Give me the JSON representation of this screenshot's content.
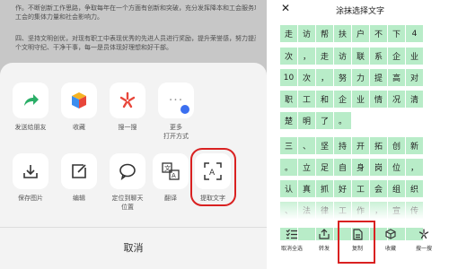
{
  "left": {
    "doc_lines": [
      "作。不断创新工作思路，争取每年在一个方面有创新和突破，充分发挥降本和工会服务功能的作用，扩大",
      "工会的集体力量和社会影响力。",
      "",
      "四、坚持文明创优，对现有职工中表现优秀的先进人员进行奖励，提升荣誉感，努力提高建设要求，每一",
      "个文明守纪、干净干事，每一是员体现好理想和好干部。"
    ],
    "share_items": [
      {
        "label": "发送给朋友",
        "icon": "share-arrow-icon"
      },
      {
        "label": "收藏",
        "icon": "favorite-cube-icon"
      },
      {
        "label": "搜一搜",
        "icon": "search-star-icon"
      },
      {
        "label": "更多\n打开方式",
        "icon": "more-icon"
      }
    ],
    "action_items": [
      {
        "label": "保存图片",
        "icon": "download-icon"
      },
      {
        "label": "编辑",
        "icon": "edit-icon"
      },
      {
        "label": "定位到聊天\n位置",
        "icon": "chat-bubble-icon"
      },
      {
        "label": "翻译",
        "icon": "translate-icon"
      },
      {
        "label": "提取文字",
        "icon": "extract-text-icon"
      }
    ],
    "cancel_label": "取消",
    "colors": {
      "sheet": "#f3f3f3",
      "highlight": "#d92121",
      "share_green": "#2aae67"
    }
  },
  "right": {
    "close_label": "✕",
    "title": "涂抹选择文字",
    "rows": [
      [
        "走",
        "访",
        "帮",
        "扶",
        "户",
        "不",
        "下",
        "4"
      ],
      [
        "次",
        "，",
        "走",
        "访",
        "联",
        "系",
        "企",
        "业"
      ],
      [
        "10",
        "次",
        "，",
        "努",
        "力",
        "提",
        "高",
        "对"
      ],
      [
        "职",
        "工",
        "和",
        "企",
        "业",
        "情",
        "况",
        "清"
      ],
      [
        "楚",
        "明",
        "了",
        "。"
      ],
      [],
      [
        "三",
        "、",
        "坚",
        "持",
        "开",
        "拓",
        "创",
        "新"
      ],
      [
        "。",
        "立",
        "足",
        "自",
        "身",
        "岗",
        "位",
        "，"
      ],
      [
        "认",
        "真",
        "抓",
        "好",
        "工",
        "会",
        "组",
        "织"
      ],
      [
        "、",
        "法",
        "律",
        "工",
        "作",
        "，",
        "宣",
        "传"
      ],
      [
        "",
        "",
        "",
        "",
        "",
        "",
        "",
        ""
      ]
    ],
    "toolbar": [
      {
        "label": "取消全选",
        "icon": "deselect-list-icon"
      },
      {
        "label": "转发",
        "icon": "forward-icon"
      },
      {
        "label": "复制",
        "icon": "copy-doc-icon"
      },
      {
        "label": "收藏",
        "icon": "favorite-cube-outline-icon"
      },
      {
        "label": "搜一搜",
        "icon": "search-star-outline-icon"
      }
    ],
    "colors": {
      "selection": "#b8ecc8"
    }
  }
}
